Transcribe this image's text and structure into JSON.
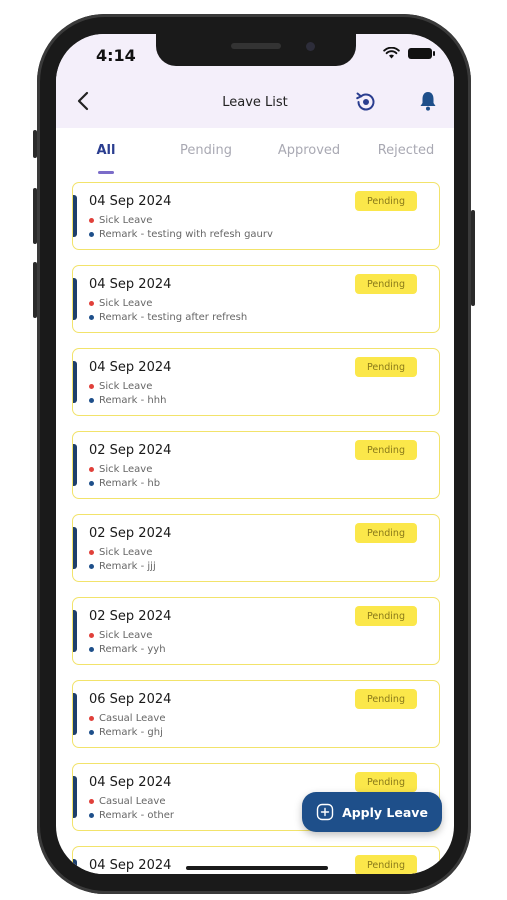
{
  "status": {
    "time": "4:14"
  },
  "header": {
    "title": "Leave List"
  },
  "tabs": [
    {
      "label": "All"
    },
    {
      "label": "Pending"
    },
    {
      "label": "Approved"
    },
    {
      "label": "Rejected"
    }
  ],
  "leaves": [
    {
      "date": "04 Sep 2024",
      "type": "Sick Leave",
      "remark": "Remark  - testing with refesh gaurv",
      "status": "Pending"
    },
    {
      "date": "04 Sep 2024",
      "type": "Sick Leave",
      "remark": "Remark  - testing after refresh",
      "status": "Pending"
    },
    {
      "date": "04 Sep 2024",
      "type": "Sick Leave",
      "remark": "Remark  - hhh",
      "status": "Pending"
    },
    {
      "date": "02 Sep 2024",
      "type": "Sick Leave",
      "remark": "Remark  - hb",
      "status": "Pending"
    },
    {
      "date": "02 Sep 2024",
      "type": "Sick Leave",
      "remark": "Remark  - jjj",
      "status": "Pending"
    },
    {
      "date": "02 Sep 2024",
      "type": "Sick Leave",
      "remark": "Remark  - yyh",
      "status": "Pending"
    },
    {
      "date": "06 Sep 2024",
      "type": "Casual Leave",
      "remark": "Remark  - ghj",
      "status": "Pending"
    },
    {
      "date": "04 Sep 2024",
      "type": "Casual Leave",
      "remark": "Remark  - other",
      "status": "Pending"
    },
    {
      "date": "04 Sep 2024",
      "type": "",
      "remark": "",
      "status": "Pending"
    }
  ],
  "fab": {
    "label": "Apply Leave"
  },
  "colors": {
    "accent": "#2a3d8f",
    "card_border": "#f2e36b",
    "badge_bg": "#fbe74a",
    "fab_bg": "#1e4f8a",
    "leave_type_dot": "#e0403a",
    "remark_dot": "#1e4f8a"
  },
  "icons": {
    "back": "chevron-left-icon",
    "sync": "sync-icon",
    "notifications": "bell-icon",
    "fab": "plus-square-icon"
  }
}
